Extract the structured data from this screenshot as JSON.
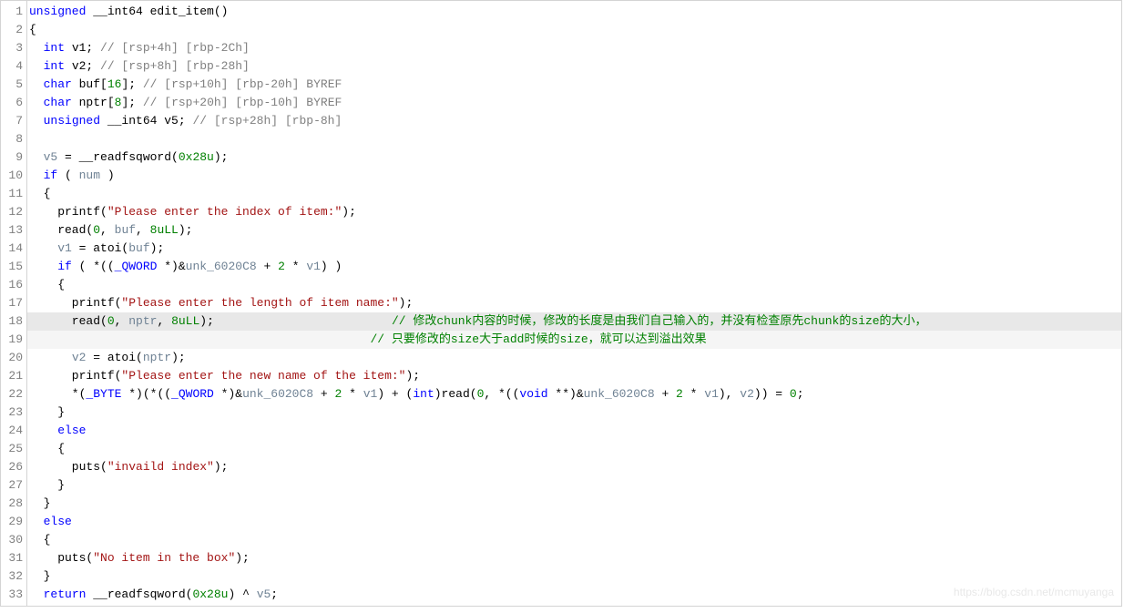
{
  "watermark": "https://blog.csdn.net/mcmuyanga",
  "lines": [
    {
      "n": 1,
      "tokens": [
        {
          "t": "unsigned",
          "c": "kw"
        },
        {
          "t": " __int64 edit_item()",
          "c": ""
        }
      ]
    },
    {
      "n": 2,
      "tokens": [
        {
          "t": "{",
          "c": ""
        }
      ]
    },
    {
      "n": 3,
      "tokens": [
        {
          "t": "  ",
          "c": ""
        },
        {
          "t": "int",
          "c": "kw"
        },
        {
          "t": " v1; ",
          "c": ""
        },
        {
          "t": "// [rsp+4h] [rbp-2Ch]",
          "c": "cmt"
        }
      ]
    },
    {
      "n": 4,
      "tokens": [
        {
          "t": "  ",
          "c": ""
        },
        {
          "t": "int",
          "c": "kw"
        },
        {
          "t": " v2; ",
          "c": ""
        },
        {
          "t": "// [rsp+8h] [rbp-28h]",
          "c": "cmt"
        }
      ]
    },
    {
      "n": 5,
      "tokens": [
        {
          "t": "  ",
          "c": ""
        },
        {
          "t": "char",
          "c": "kw"
        },
        {
          "t": " buf[",
          "c": ""
        },
        {
          "t": "16",
          "c": "num"
        },
        {
          "t": "]; ",
          "c": ""
        },
        {
          "t": "// [rsp+10h] [rbp-20h] BYREF",
          "c": "cmt"
        }
      ]
    },
    {
      "n": 6,
      "tokens": [
        {
          "t": "  ",
          "c": ""
        },
        {
          "t": "char",
          "c": "kw"
        },
        {
          "t": " nptr[",
          "c": ""
        },
        {
          "t": "8",
          "c": "num"
        },
        {
          "t": "]; ",
          "c": ""
        },
        {
          "t": "// [rsp+20h] [rbp-10h] BYREF",
          "c": "cmt"
        }
      ]
    },
    {
      "n": 7,
      "tokens": [
        {
          "t": "  ",
          "c": ""
        },
        {
          "t": "unsigned",
          "c": "kw"
        },
        {
          "t": " __int64 v5; ",
          "c": ""
        },
        {
          "t": "// [rsp+28h] [rbp-8h]",
          "c": "cmt"
        }
      ]
    },
    {
      "n": 8,
      "tokens": [
        {
          "t": "",
          "c": ""
        }
      ]
    },
    {
      "n": 9,
      "tokens": [
        {
          "t": "  ",
          "c": ""
        },
        {
          "t": "v5",
          "c": "var"
        },
        {
          "t": " = __readfsqword(",
          "c": ""
        },
        {
          "t": "0x28u",
          "c": "num"
        },
        {
          "t": ");",
          "c": ""
        }
      ]
    },
    {
      "n": 10,
      "tokens": [
        {
          "t": "  ",
          "c": ""
        },
        {
          "t": "if",
          "c": "kw"
        },
        {
          "t": " ( ",
          "c": ""
        },
        {
          "t": "num",
          "c": "global"
        },
        {
          "t": " )",
          "c": ""
        }
      ]
    },
    {
      "n": 11,
      "tokens": [
        {
          "t": "  {",
          "c": ""
        }
      ]
    },
    {
      "n": 12,
      "tokens": [
        {
          "t": "    printf(",
          "c": ""
        },
        {
          "t": "\"Please enter the index of item:\"",
          "c": "str"
        },
        {
          "t": ");",
          "c": ""
        }
      ]
    },
    {
      "n": 13,
      "tokens": [
        {
          "t": "    read(",
          "c": ""
        },
        {
          "t": "0",
          "c": "num"
        },
        {
          "t": ", ",
          "c": ""
        },
        {
          "t": "buf",
          "c": "var"
        },
        {
          "t": ", ",
          "c": ""
        },
        {
          "t": "8uLL",
          "c": "num"
        },
        {
          "t": ");",
          "c": ""
        }
      ]
    },
    {
      "n": 14,
      "tokens": [
        {
          "t": "    ",
          "c": ""
        },
        {
          "t": "v1",
          "c": "var"
        },
        {
          "t": " = atoi(",
          "c": ""
        },
        {
          "t": "buf",
          "c": "var"
        },
        {
          "t": ");",
          "c": ""
        }
      ]
    },
    {
      "n": 15,
      "tokens": [
        {
          "t": "    ",
          "c": ""
        },
        {
          "t": "if",
          "c": "kw"
        },
        {
          "t": " ( *((",
          "c": ""
        },
        {
          "t": "_QWORD",
          "c": "kw"
        },
        {
          "t": " *)&",
          "c": ""
        },
        {
          "t": "unk_6020C8",
          "c": "global"
        },
        {
          "t": " + ",
          "c": ""
        },
        {
          "t": "2",
          "c": "num"
        },
        {
          "t": " * ",
          "c": ""
        },
        {
          "t": "v1",
          "c": "var"
        },
        {
          "t": ") )",
          "c": ""
        }
      ]
    },
    {
      "n": 16,
      "tokens": [
        {
          "t": "    {",
          "c": ""
        }
      ]
    },
    {
      "n": 17,
      "tokens": [
        {
          "t": "      printf(",
          "c": ""
        },
        {
          "t": "\"Please enter the length of item name:\"",
          "c": "str"
        },
        {
          "t": ");",
          "c": ""
        }
      ]
    },
    {
      "n": 18,
      "hl": true,
      "tokens": [
        {
          "t": "      read(",
          "c": ""
        },
        {
          "t": "0",
          "c": "num"
        },
        {
          "t": ", ",
          "c": ""
        },
        {
          "t": "nptr",
          "c": "var"
        },
        {
          "t": ", ",
          "c": ""
        },
        {
          "t": "8uLL",
          "c": "num"
        },
        {
          "t": ");                         ",
          "c": ""
        },
        {
          "t": "// 修改chunk内容的时候，修改的长度是由我们自己输入的，并没有检查原先chunk的size的大小，",
          "c": "cmtgreen"
        }
      ]
    },
    {
      "n": 19,
      "hlc": true,
      "tokens": [
        {
          "t": "                                                ",
          "c": ""
        },
        {
          "t": "// 只要修改的size大于add时候的size，就可以达到溢出效果",
          "c": "cmtgreen"
        }
      ]
    },
    {
      "n": 20,
      "tokens": [
        {
          "t": "      ",
          "c": ""
        },
        {
          "t": "v2",
          "c": "var"
        },
        {
          "t": " = atoi(",
          "c": ""
        },
        {
          "t": "nptr",
          "c": "var"
        },
        {
          "t": ");",
          "c": ""
        }
      ]
    },
    {
      "n": 21,
      "tokens": [
        {
          "t": "      printf(",
          "c": ""
        },
        {
          "t": "\"Please enter the new name of the item:\"",
          "c": "str"
        },
        {
          "t": ");",
          "c": ""
        }
      ]
    },
    {
      "n": 22,
      "tokens": [
        {
          "t": "      *(",
          "c": ""
        },
        {
          "t": "_BYTE",
          "c": "kw"
        },
        {
          "t": " *)(*((",
          "c": ""
        },
        {
          "t": "_QWORD",
          "c": "kw"
        },
        {
          "t": " *)&",
          "c": ""
        },
        {
          "t": "unk_6020C8",
          "c": "global"
        },
        {
          "t": " + ",
          "c": ""
        },
        {
          "t": "2",
          "c": "num"
        },
        {
          "t": " * ",
          "c": ""
        },
        {
          "t": "v1",
          "c": "var"
        },
        {
          "t": ") + (",
          "c": ""
        },
        {
          "t": "int",
          "c": "kw"
        },
        {
          "t": ")read(",
          "c": ""
        },
        {
          "t": "0",
          "c": "num"
        },
        {
          "t": ", *((",
          "c": ""
        },
        {
          "t": "void",
          "c": "kw"
        },
        {
          "t": " **)&",
          "c": ""
        },
        {
          "t": "unk_6020C8",
          "c": "global"
        },
        {
          "t": " + ",
          "c": ""
        },
        {
          "t": "2",
          "c": "num"
        },
        {
          "t": " * ",
          "c": ""
        },
        {
          "t": "v1",
          "c": "var"
        },
        {
          "t": "), ",
          "c": ""
        },
        {
          "t": "v2",
          "c": "var"
        },
        {
          "t": ")) = ",
          "c": ""
        },
        {
          "t": "0",
          "c": "num"
        },
        {
          "t": ";",
          "c": ""
        }
      ]
    },
    {
      "n": 23,
      "tokens": [
        {
          "t": "    }",
          "c": ""
        }
      ]
    },
    {
      "n": 24,
      "tokens": [
        {
          "t": "    ",
          "c": ""
        },
        {
          "t": "else",
          "c": "kw"
        }
      ]
    },
    {
      "n": 25,
      "tokens": [
        {
          "t": "    {",
          "c": ""
        }
      ]
    },
    {
      "n": 26,
      "tokens": [
        {
          "t": "      puts(",
          "c": ""
        },
        {
          "t": "\"invaild index\"",
          "c": "str"
        },
        {
          "t": ");",
          "c": ""
        }
      ]
    },
    {
      "n": 27,
      "tokens": [
        {
          "t": "    }",
          "c": ""
        }
      ]
    },
    {
      "n": 28,
      "tokens": [
        {
          "t": "  }",
          "c": ""
        }
      ]
    },
    {
      "n": 29,
      "tokens": [
        {
          "t": "  ",
          "c": ""
        },
        {
          "t": "else",
          "c": "kw"
        }
      ]
    },
    {
      "n": 30,
      "tokens": [
        {
          "t": "  {",
          "c": ""
        }
      ]
    },
    {
      "n": 31,
      "tokens": [
        {
          "t": "    puts(",
          "c": ""
        },
        {
          "t": "\"No item in the box\"",
          "c": "str"
        },
        {
          "t": ");",
          "c": ""
        }
      ]
    },
    {
      "n": 32,
      "tokens": [
        {
          "t": "  }",
          "c": ""
        }
      ]
    },
    {
      "n": 33,
      "tokens": [
        {
          "t": "  ",
          "c": ""
        },
        {
          "t": "return",
          "c": "kw"
        },
        {
          "t": " __readfsqword(",
          "c": ""
        },
        {
          "t": "0x28u",
          "c": "num"
        },
        {
          "t": ") ^ ",
          "c": ""
        },
        {
          "t": "v5",
          "c": "var"
        },
        {
          "t": ";",
          "c": ""
        }
      ]
    }
  ]
}
